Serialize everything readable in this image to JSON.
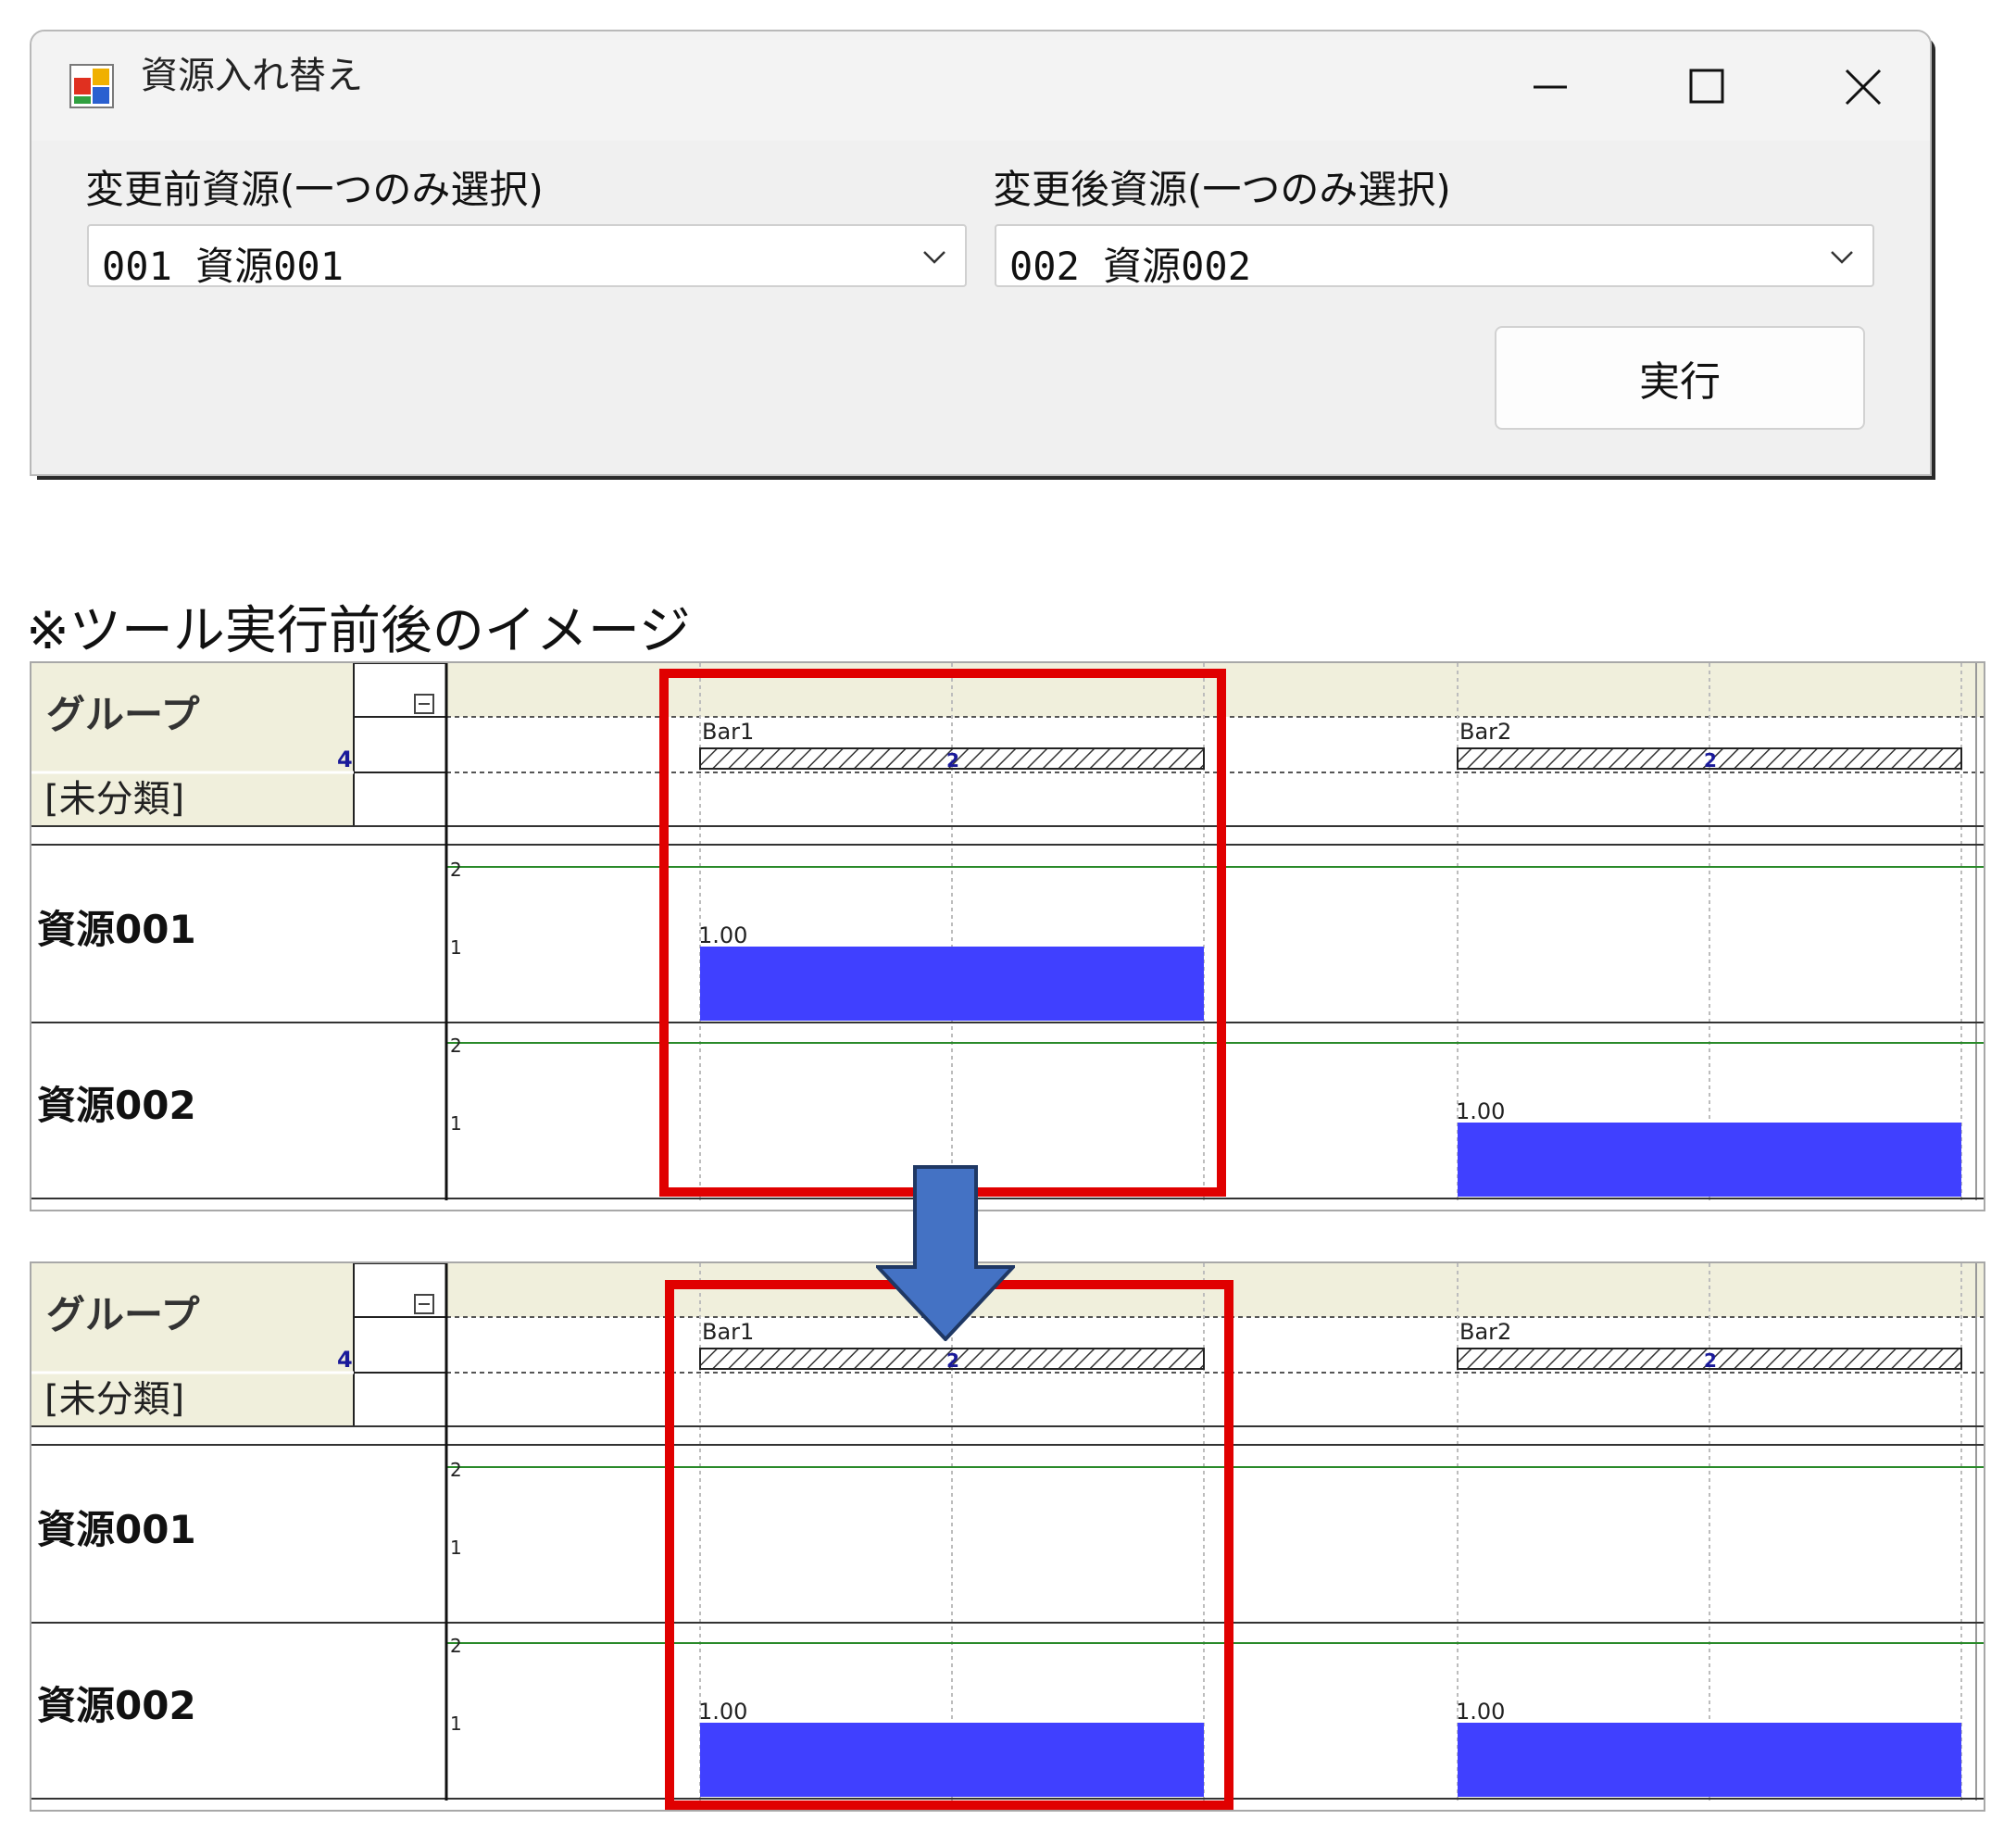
{
  "dialog": {
    "title": "資源入れ替え",
    "before_label": "変更前資源(一つのみ選択)",
    "after_label": "変更後資源(一つのみ選択)",
    "before_value": "001 資源001",
    "after_value": "002 資源002",
    "execute_label": "実行"
  },
  "caption": "※ツール実行前後のイメージ",
  "gantt": {
    "group_label": "グループ",
    "group_count": "4",
    "unclassified_label": "[未分類]",
    "bars": [
      {
        "name": "Bar1",
        "count": "2"
      },
      {
        "name": "Bar2",
        "count": "2"
      }
    ],
    "axis_ticks": [
      "2",
      "1"
    ],
    "before": {
      "rows": [
        {
          "name": "資源001",
          "loads": [
            {
              "bar": 0,
              "value": 1.0,
              "label": "1.00"
            }
          ]
        },
        {
          "name": "資源002",
          "loads": [
            {
              "bar": 1,
              "value": 1.0,
              "label": "1.00"
            }
          ]
        }
      ]
    },
    "after": {
      "rows": [
        {
          "name": "資源001",
          "loads": []
        },
        {
          "name": "資源002",
          "loads": [
            {
              "bar": 0,
              "value": 1.0,
              "label": "1.00"
            },
            {
              "bar": 1,
              "value": 1.0,
              "label": "1.00"
            }
          ]
        }
      ]
    }
  },
  "colors": {
    "load_bar": "#4040ff",
    "highlight": "#e00000",
    "arrow": "#4472c4",
    "header_bg": "#f0efdc",
    "scale_line": "#2a8a2a"
  }
}
